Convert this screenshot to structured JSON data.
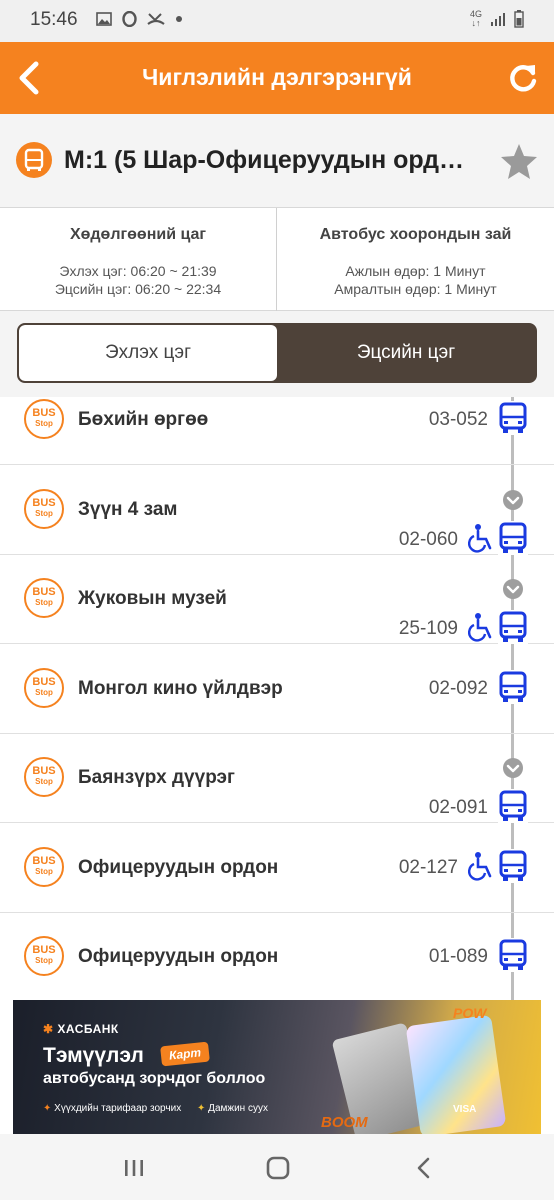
{
  "status_bar": {
    "time": "15:46",
    "network_label": "4G",
    "icons_left": [
      "image-icon",
      "opera-icon",
      "missed-call-icon",
      "dot-icon"
    ],
    "icons_right": [
      "network-icon",
      "signal-icon",
      "battery-icon"
    ]
  },
  "header": {
    "title": "Чиглэлийн дэлгэрэнгүй",
    "accent_color": "#f5821f"
  },
  "route": {
    "title": "М:1 (5 Шар-Офицеруудын орд…"
  },
  "info": {
    "schedule_heading": "Хөдөлгөөний цаг",
    "schedule_start": "Эхлэх цэг: 06:20 ~ 21:39",
    "schedule_end": "Эцсийн цэг: 06:20 ~ 22:34",
    "interval_heading": "Автобус хоорондын зай",
    "interval_weekday": "Ажлын өдөр: 1 Минут",
    "interval_weekend": "Амралтын өдөр: 1 Минут"
  },
  "segment": {
    "start_label": "Эхлэх цэг",
    "end_label": "Эцсийн цэг",
    "selected": "start",
    "active_color": "#4e4239"
  },
  "bus_stop_badge": {
    "line1": "BUS",
    "line2": "Stop"
  },
  "stops": [
    {
      "name": "Бөхийн өргөө",
      "code": "03-052",
      "wheelchair": false,
      "bus_arriving": false
    },
    {
      "name": "Зүүн 4 зам",
      "code": "02-060",
      "wheelchair": true,
      "bus_arriving": true
    },
    {
      "name": "Жуковын музей",
      "code": "25-109",
      "wheelchair": true,
      "bus_arriving": true
    },
    {
      "name": "Монгол кино үйлдвэр",
      "code": "02-092",
      "wheelchair": false,
      "bus_arriving": false
    },
    {
      "name": "Баянзүрх дүүрэг",
      "code": "02-091",
      "wheelchair": false,
      "bus_arriving": true
    },
    {
      "name": "Офицеруудын ордон",
      "code": "02-127",
      "wheelchair": true,
      "bus_arriving": false
    },
    {
      "name": "Офицеруудын ордон",
      "code": "01-089",
      "wheelchair": false,
      "bus_arriving": false
    }
  ],
  "banner": {
    "bank": "ХАСБАНК",
    "line1": "Тэмүүлэл",
    "tag": "Карт",
    "line2": "автобусанд зорчдог боллоо",
    "bullet1": "Хүүхдийн тарифаар зорчих",
    "bullet2": "Дамжин суух",
    "pow": "POW",
    "boom": "BOOM",
    "visa": "VISA"
  },
  "icon_color": "#1a3ae0"
}
